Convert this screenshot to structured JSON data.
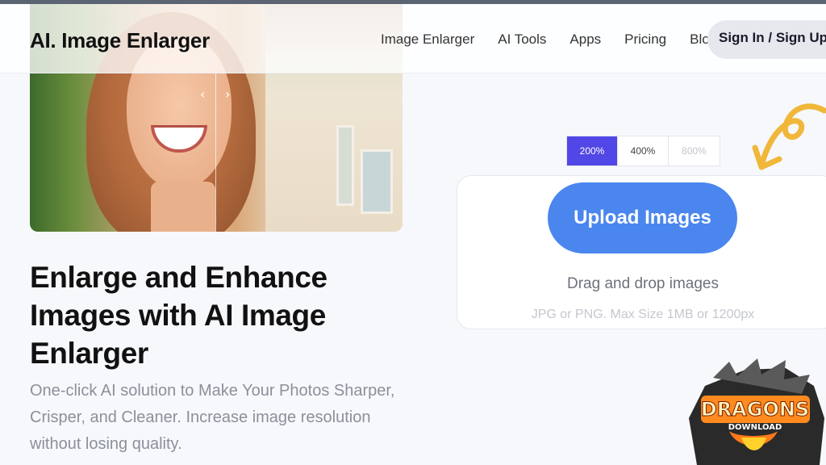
{
  "brand": "AI. Image Enlarger",
  "nav": {
    "links": [
      "Image Enlarger",
      "AI Tools",
      "Apps",
      "Pricing",
      "Blog"
    ],
    "signin": "Sign In / Sign Up"
  },
  "hero": {
    "headline": "Enlarge and Enhance Images with AI Image Enlarger",
    "subtext": "One-click AI solution to Make Your Photos Sharper, Crisper, and Cleaner. Increase image resolution without losing quality."
  },
  "scales": {
    "options": [
      "200%",
      "400%",
      "800%"
    ],
    "selected": "200%"
  },
  "upload": {
    "button": "Upload Images",
    "drag_text": "Drag and drop images",
    "limits": "JPG or PNG. Max Size 1MB or 1200px"
  },
  "watermark": {
    "line1": "DRAGONS",
    "line2": "DOWNLOAD"
  },
  "colors": {
    "accent": "#5147e6",
    "upload_button": "#4a86ee",
    "arrow": "#f0b73a"
  }
}
